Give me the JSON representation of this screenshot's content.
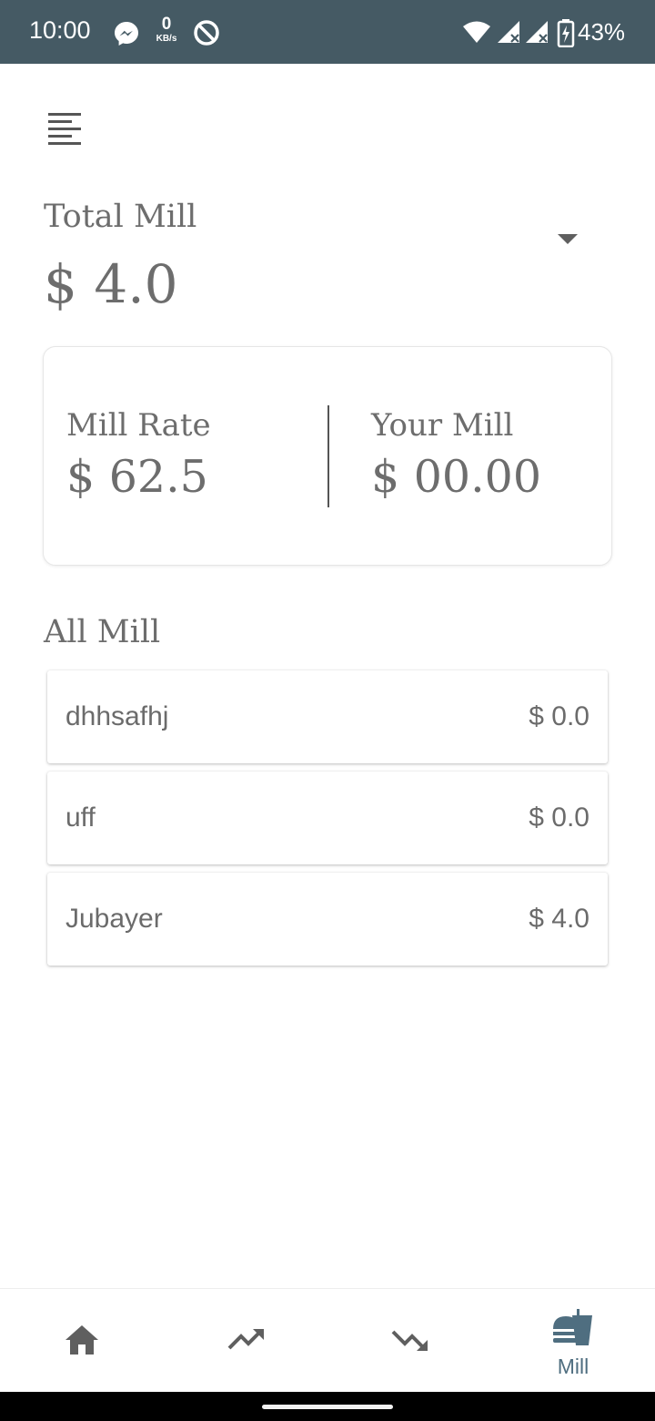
{
  "status_bar": {
    "time": "10:00",
    "speed_value": "0",
    "speed_unit": "KB/s",
    "network_type": "4",
    "battery": "43%"
  },
  "header": {
    "menu_icon": "menu-lines-icon",
    "dropdown_icon": "dropdown-arrow-icon"
  },
  "total": {
    "label": "Total Mill",
    "value": "$ 4.0"
  },
  "card": {
    "rate_label": "Mill Rate",
    "rate_value": "$ 62.5",
    "your_label": "Your Mill",
    "your_value": "$ 00.00"
  },
  "list": {
    "title": "All Mill",
    "items": [
      {
        "name": "dhhsafhj",
        "amount": "$ 0.0"
      },
      {
        "name": "uff",
        "amount": "$ 0.0"
      },
      {
        "name": "Jubayer",
        "amount": "$ 4.0"
      }
    ]
  },
  "bottom_nav": {
    "items": [
      {
        "icon": "home-icon",
        "label": ""
      },
      {
        "icon": "trending-up-icon",
        "label": ""
      },
      {
        "icon": "trending-down-icon",
        "label": ""
      },
      {
        "icon": "food-icon",
        "label": "Mill",
        "active": true
      }
    ]
  },
  "colors": {
    "status_bar": "#455a64",
    "text": "#6d6d6d",
    "accent": "#4f6e80",
    "nav_icon": "#5f5f5f"
  }
}
